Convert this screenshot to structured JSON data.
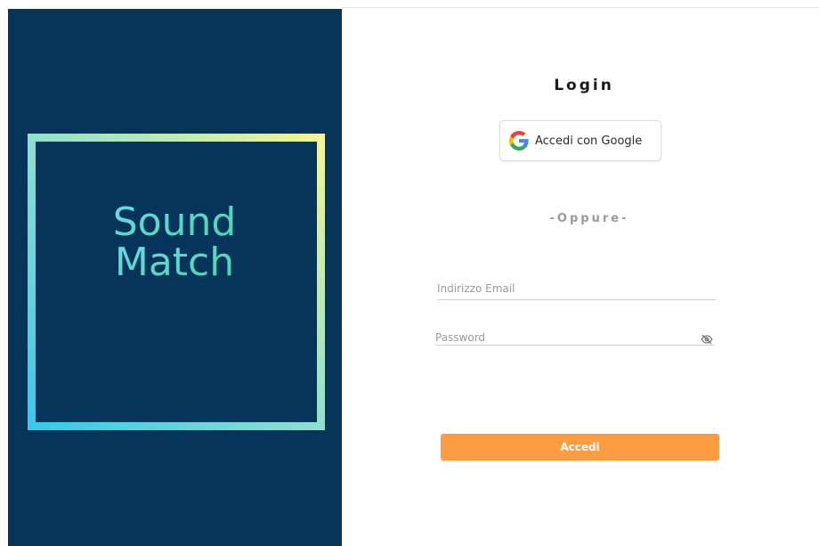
{
  "brand": {
    "line1": "Sound",
    "line2": "Match",
    "panel_color": "#06345a",
    "gradient_start": "#7fd9e6",
    "gradient_end": "#49d6a8"
  },
  "login": {
    "title": "Login",
    "google_button_label": "Accedi con Google",
    "divider_text": "-Oppure-",
    "email_placeholder": "Indirizzo Email",
    "password_placeholder": "Password",
    "submit_label": "Accedi",
    "accent_color": "#fd9c43"
  },
  "icons": {
    "google": "google-icon",
    "visibility": "eye-off-icon"
  }
}
